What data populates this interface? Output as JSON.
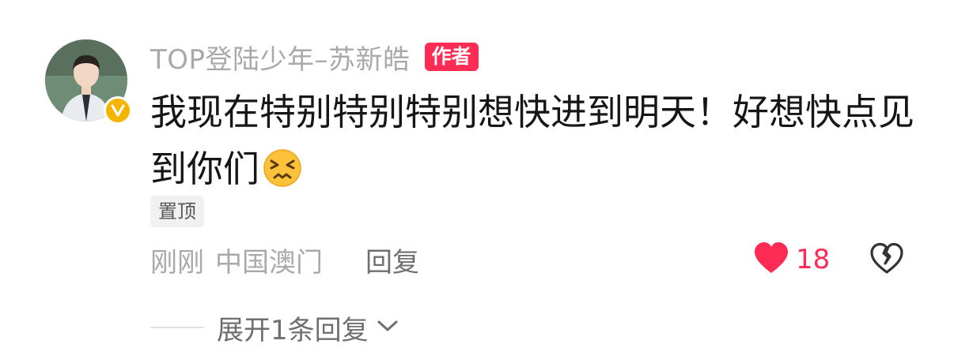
{
  "comment": {
    "username": "TOP登陆少年–苏新皓",
    "author_badge": "作者",
    "text": "我现在特别特别特别想快进到明天！好想快点见到你们",
    "emoji": "confounded-face",
    "pinned_label": "置顶",
    "time": "刚刚",
    "location": "中国澳门",
    "reply_label": "回复",
    "like_count": "18",
    "expand_label": "展开1条回复"
  },
  "colors": {
    "accent": "#fe2c55",
    "verified": "#f4b400",
    "muted_text": "#a9a9a9",
    "body_text": "#161616"
  },
  "icons": {
    "verified": "verified-v-icon",
    "like": "heart-icon",
    "dislike": "broken-heart-icon",
    "expand": "chevron-down-icon"
  }
}
